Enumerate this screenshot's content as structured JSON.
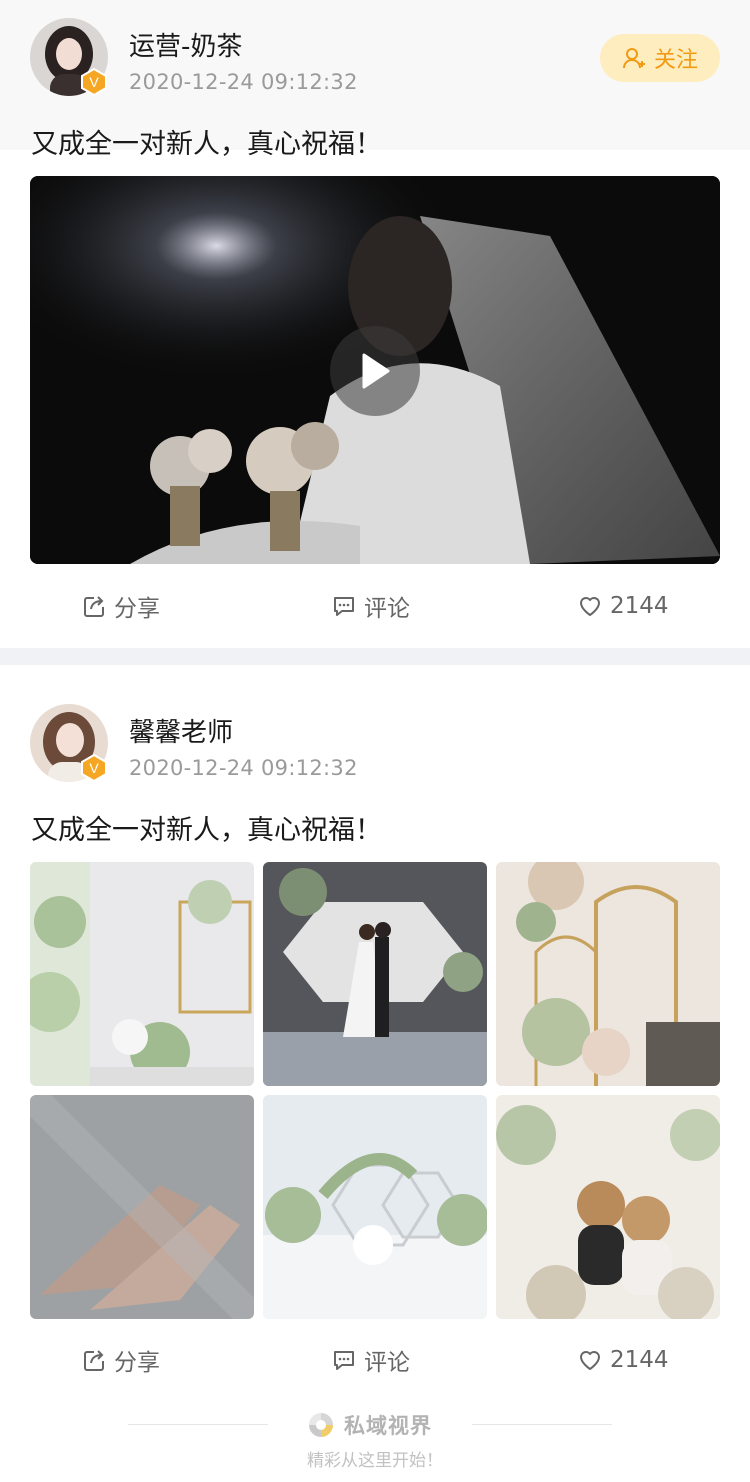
{
  "posts": [
    {
      "author": "运营-奶茶",
      "time": "2020-12-24  09:12:32",
      "follow_label": "关注",
      "caption": "又成全一对新人，真心祝福！",
      "media_type": "video",
      "actions": {
        "share": "分享",
        "comment": "评论",
        "likes": "2144"
      }
    },
    {
      "author": "馨馨老师",
      "time": "2020-12-24  09:12:32",
      "caption": "又成全一对新人，真心祝福！",
      "media_type": "image-grid",
      "images": [
        "wedding-welcome-sign",
        "couple-on-stage",
        "gold-arch-flowers",
        "bridal-shoes",
        "floral-hexagon-arch",
        "teddy-bear-couple"
      ],
      "actions": {
        "share": "分享",
        "comment": "评论",
        "likes": "2144"
      }
    }
  ],
  "footer": {
    "brand": "私域视界",
    "slogan": "精彩从这里开始！"
  },
  "colors": {
    "accent": "#f29a12",
    "follow_bg": "#fdedbf",
    "badge": "#f5a623",
    "muted": "#9a9a9a"
  }
}
